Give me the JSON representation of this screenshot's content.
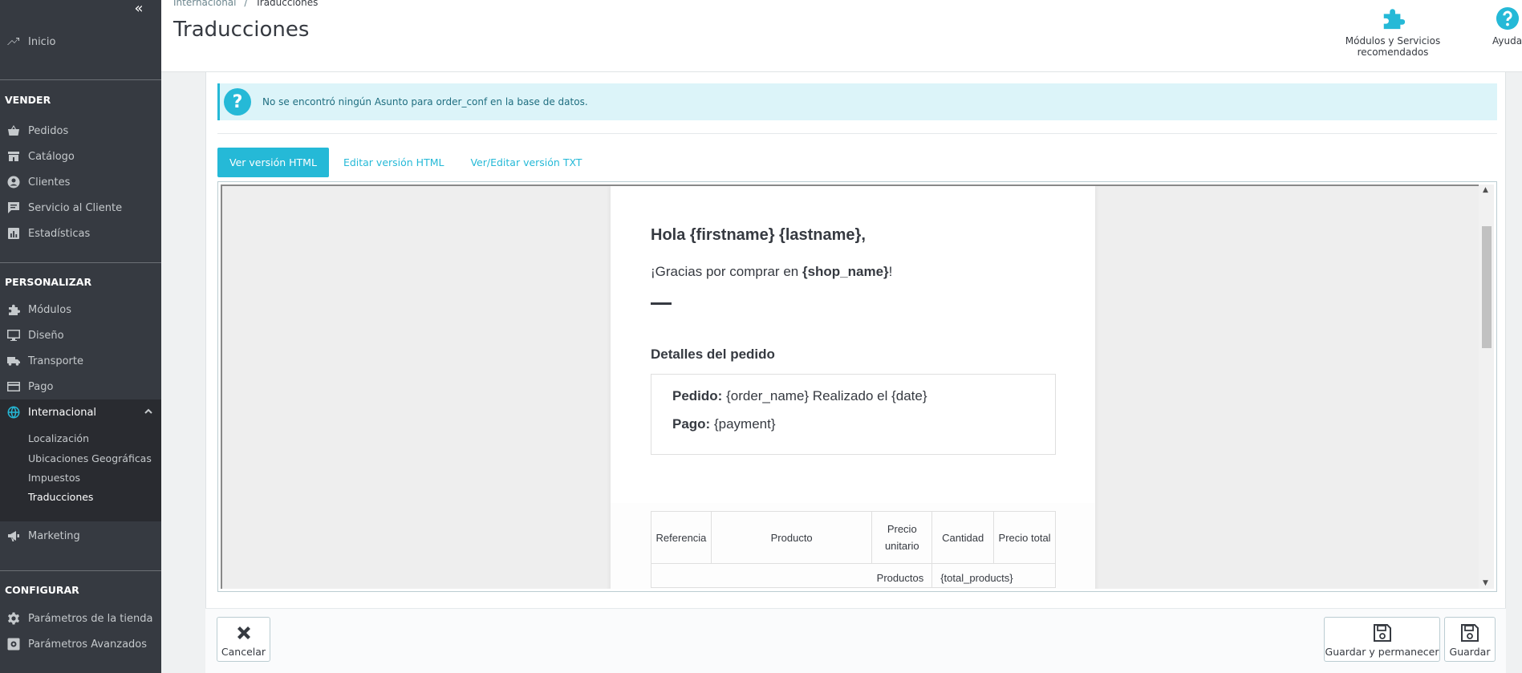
{
  "sidebar": {
    "collapse_icon": "«",
    "home": "Inicio",
    "sections": {
      "sell": "VENDER",
      "customize": "PERSONALIZAR",
      "configure": "CONFIGURAR"
    },
    "sell_items": [
      "Pedidos",
      "Catálogo",
      "Clientes",
      "Servicio al Cliente",
      "Estadísticas"
    ],
    "customize_items": [
      "Módulos",
      "Diseño",
      "Transporte",
      "Pago",
      "Internacional"
    ],
    "international_sub": [
      "Localización",
      "Ubicaciones Geográficas",
      "Impuestos",
      "Traducciones"
    ],
    "marketing": "Marketing",
    "configure_items": [
      "Parámetros de la tienda",
      "Parámetros Avanzados"
    ]
  },
  "header": {
    "breadcrumb_parent": "Internacional",
    "breadcrumb_sep": "/",
    "breadcrumb_current": "Traducciones",
    "title": "Traducciones",
    "modules_label": "Módulos y Servicios recomendados",
    "help_label": "Ayuda"
  },
  "alert": {
    "icon": "?",
    "text": "No se encontró ningún Asunto para order_conf en la base de datos."
  },
  "tabs": [
    "Ver versión HTML",
    "Editar versión HTML",
    "Ver/Editar versión TXT"
  ],
  "email": {
    "greeting": "Hola {firstname} {lastname},",
    "thanks_prefix": "¡Gracias por comprar en ",
    "thanks_shop": "{shop_name}",
    "thanks_suffix": "!",
    "details_heading": "Detalles del pedido",
    "order_label": "Pedido:",
    "order_value": " {order_name} Realizado el {date}",
    "payment_label": "Pago:",
    "payment_value": " {payment}",
    "table_headers": [
      "Referencia",
      "Producto",
      "Precio unitario",
      "Cantidad",
      "Precio total"
    ],
    "row_label": "Productos",
    "row_value": "{total_products}"
  },
  "footer": {
    "cancel": "Cancelar",
    "save_stay": "Guardar y permanecer",
    "save": "Guardar"
  },
  "colors": {
    "accent": "#25b9d7",
    "sidebar_bg": "#363a41",
    "sidebar_active_bg": "#292b30"
  }
}
